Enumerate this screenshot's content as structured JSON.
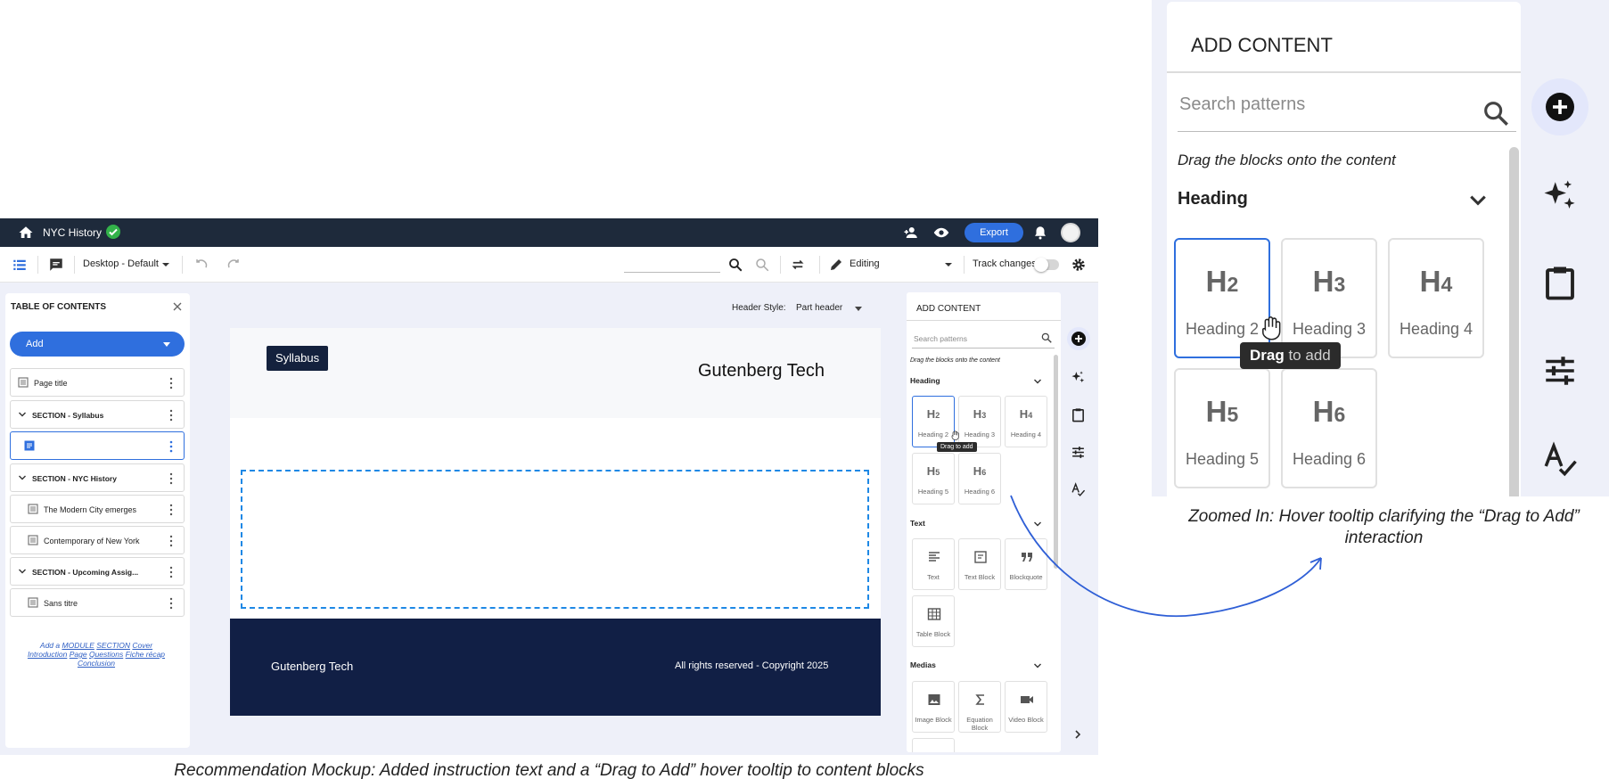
{
  "app": {
    "title": "NYC History",
    "export_label": "Export",
    "device_select": "Desktop - Default",
    "mode_select": "Editing",
    "track_changes_label": "Track changes"
  },
  "toc": {
    "heading": "TABLE OF CONTENTS",
    "add_label": "Add",
    "items": [
      {
        "label": "Page title"
      },
      {
        "label": "SECTION  - Syllabus"
      },
      {
        "label": ""
      },
      {
        "label": "SECTION  - NYC History"
      },
      {
        "label": "The Modern City emerges"
      },
      {
        "label": "Contemporary of New York"
      },
      {
        "label": "SECTION  - Upcoming Assig..."
      },
      {
        "label": "Sans titre"
      }
    ],
    "add_links": {
      "prefix": "Add a",
      "links": [
        "MODULE",
        "SECTION",
        "Cover",
        "Introduction",
        "Page",
        "Questions",
        "Fiche récap",
        "Conclusion"
      ]
    }
  },
  "canvas": {
    "header_style_label": "Header Style:",
    "header_style_value": "Part header",
    "chip_label": "Syllabus",
    "brand": "Gutenberg Tech",
    "footer_left": "Gutenberg Tech",
    "footer_right": "All rights reserved - Copyright 2025"
  },
  "add_content": {
    "title": "ADD CONTENT",
    "search_placeholder": "Search patterns",
    "hint": "Drag the blocks onto the content",
    "sections": {
      "heading": "Heading",
      "text": "Text",
      "medias": "Medias"
    },
    "heading_blocks": [
      {
        "glyph": "H",
        "level": "2",
        "label": "Heading 2"
      },
      {
        "glyph": "H",
        "level": "3",
        "label": "Heading 3"
      },
      {
        "glyph": "H",
        "level": "4",
        "label": "Heading 4"
      },
      {
        "glyph": "H",
        "level": "5",
        "label": "Heading 5"
      },
      {
        "glyph": "H",
        "level": "6",
        "label": "Heading 6"
      }
    ],
    "text_blocks": [
      {
        "label": "Text",
        "icon": "text-align-icon"
      },
      {
        "label": "Text Block",
        "icon": "text-block-icon"
      },
      {
        "label": "Blockquote",
        "icon": "quote-icon"
      },
      {
        "label": "Table Block",
        "icon": "table-icon"
      }
    ],
    "media_blocks": [
      {
        "label": "Image Block",
        "icon": "image-icon"
      },
      {
        "label": "Equation Block",
        "icon": "sigma-icon"
      },
      {
        "label": "Video Block",
        "icon": "video-icon"
      }
    ],
    "tooltip_small": "Drag to add",
    "tooltip_bold": "Drag",
    "tooltip_rest": " to add"
  },
  "captions": {
    "mockup": "Recommendation Mockup: Added instruction text and a “Drag to Add” hover tooltip to content blocks",
    "zoom": "Zoomed In: Hover tooltip clarifying the “Drag to Add” interaction"
  },
  "colors": {
    "topbar": "#1e2a3b",
    "accent": "#2f6fde",
    "footer": "#111f45",
    "dropzone": "#1e88e5",
    "status_ok": "#33b24a"
  }
}
